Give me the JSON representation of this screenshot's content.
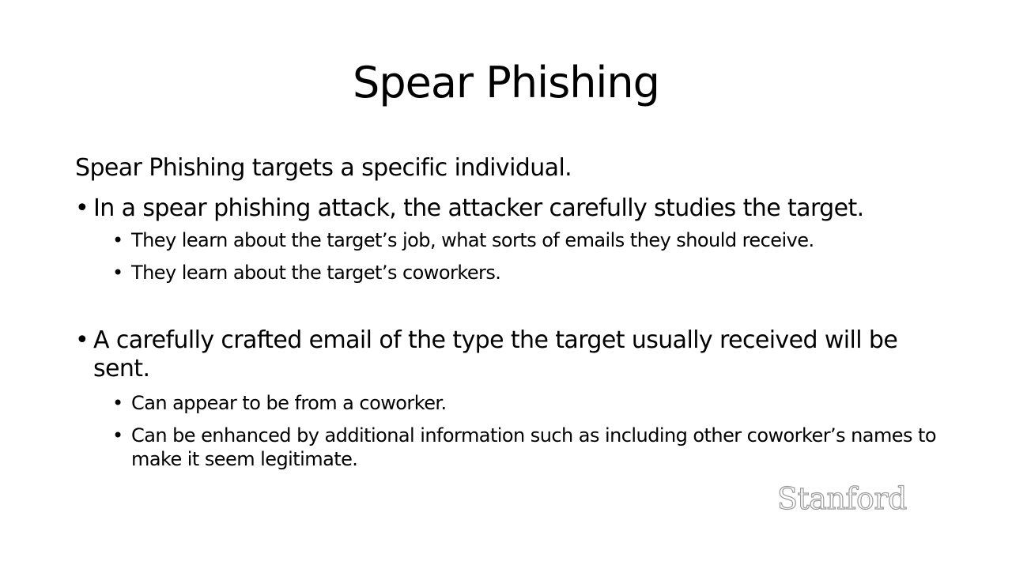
{
  "slide": {
    "title": "Spear Phishing",
    "intro": "Spear Phishing targets a specific individual.",
    "bullet_glyph": "•",
    "points": [
      {
        "text": "In a spear phishing attack, the attacker carefully studies the target.",
        "subpoints": [
          "They learn about the target’s job, what sorts of emails they should receive.",
          "They learn about the target’s coworkers."
        ]
      },
      {
        "text": "A carefully crafted email of the type the target usually received will be sent.",
        "subpoints": [
          "Can appear to be from a coworker.",
          "Can be enhanced by additional information such as including other coworker’s names to make it seem legitimate."
        ]
      }
    ],
    "logo_text": "Stanford"
  },
  "colors": {
    "background": "#ffffff",
    "text": "#000000",
    "logo_outline": "#9a9a9a"
  }
}
